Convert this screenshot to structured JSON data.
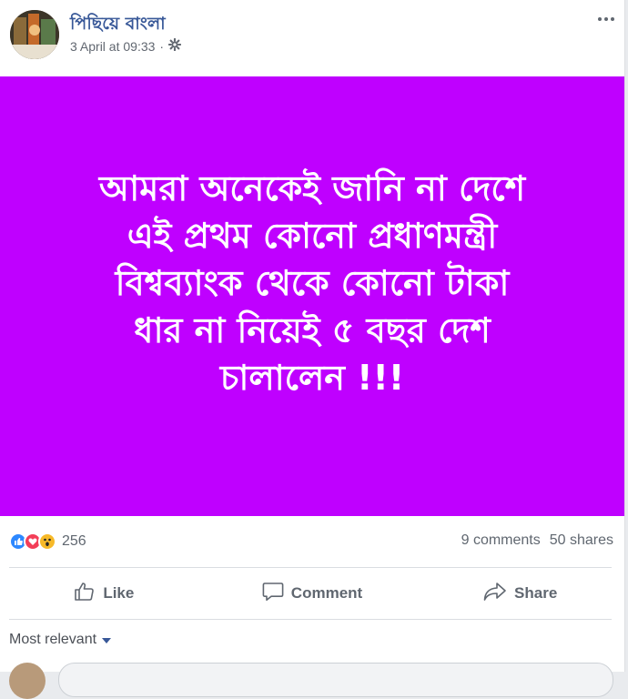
{
  "post": {
    "page_name": "পিছিয়ে বাংলা",
    "timestamp": "3 April at 09:33",
    "separator": "·",
    "image_text": "আমরা অনেকেই জানি না দেশে\nএই প্রথম কোনো প্রধাণমন্ত্রী\nবিশ্বব্যাংক থেকে কোনো টাকা\nধার না নিয়েই ৫ বছর দেশ\nচালালেন !!!",
    "image_bg_color": "#bf00ff"
  },
  "stats": {
    "reaction_count": "256",
    "comments": "9 comments",
    "shares": "50 shares"
  },
  "actions": {
    "like": "Like",
    "comment": "Comment",
    "share": "Share"
  },
  "comments_section": {
    "filter_label": "Most relevant"
  }
}
